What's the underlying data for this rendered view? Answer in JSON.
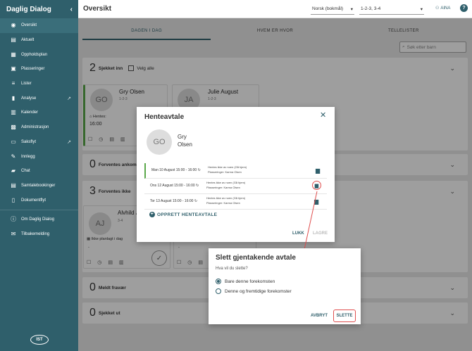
{
  "app": {
    "title": "Daglig Dialog",
    "collapse_icon": "chevron-left-icon"
  },
  "sidebar": {
    "items": [
      {
        "label": "Oversikt",
        "icon": "eye-icon",
        "active": true
      },
      {
        "label": "Aktuelt",
        "icon": "news-icon"
      },
      {
        "label": "Oppholdsplan",
        "icon": "calendar-plan-icon"
      },
      {
        "label": "Plasseringer",
        "icon": "person-card-icon"
      },
      {
        "label": "Lister",
        "icon": "list-icon"
      },
      {
        "label": "Analyse",
        "icon": "bar-chart-icon",
        "external": true
      },
      {
        "label": "Kalender",
        "icon": "calendar-icon"
      },
      {
        "label": "Administrasjon",
        "icon": "admin-icon"
      },
      {
        "label": "Saksflyt",
        "icon": "folder-icon",
        "external": true
      },
      {
        "label": "Innlegg",
        "icon": "pencil-icon"
      },
      {
        "label": "Chat",
        "icon": "chat-icon"
      },
      {
        "label": "Samtalebookinger",
        "icon": "booking-icon"
      },
      {
        "label": "Dokumentflyt",
        "icon": "document-icon"
      }
    ],
    "footer_items": [
      {
        "label": "Om Daglig Dialog",
        "icon": "info-icon"
      },
      {
        "label": "Tilbakemelding",
        "icon": "feedback-icon"
      }
    ],
    "logo_text": "IST"
  },
  "topbar": {
    "title": "Oversikt",
    "language": "Norsk (bokmål)",
    "filter": "1-2-3, 3-4",
    "user": "AINA",
    "help": "?"
  },
  "tabs": [
    {
      "label": "DAGEN I DAG",
      "active": true
    },
    {
      "label": "HVEM ER HVOR"
    },
    {
      "label": "TELLELISTER"
    }
  ],
  "search": {
    "placeholder": "Søk etter barn"
  },
  "sections": {
    "checked_in": {
      "count": "2",
      "label": "Sjekket inn",
      "select_all": "Velg alle"
    },
    "expected": {
      "count": "0",
      "label": "Forventes ankomm"
    },
    "not_expected": {
      "count": "3",
      "label": "Forventes ikke"
    },
    "absent": {
      "count": "0",
      "label": "Meldt fravær"
    },
    "checked_out": {
      "count": "0",
      "label": "Sjekket ut"
    }
  },
  "cards": {
    "gry": {
      "initials": "GO",
      "name": "Gry Olsen",
      "dept": "1-2-3",
      "pickup_label": "Hentes:",
      "pickup_time": "16:00"
    },
    "julie": {
      "initials": "JA",
      "name": "Julie August",
      "dept": "1-2-3"
    },
    "alvhild": {
      "initials": "AJ",
      "name": "Alvhild Jo",
      "dept": "3-4",
      "status": "Ikke planlagt i dag",
      "dash": "-"
    },
    "other_dash": "-"
  },
  "pickup_dialog": {
    "title": "Henteavtale",
    "child_initials": "GO",
    "child_first": "Gry",
    "child_last": "Olsen",
    "appointments": [
      {
        "date": "Man 10 August 15:00 - 16:00",
        "line1": "Hentes ikke av noen (Gå hjem)",
        "line2": "Plasseringer: Karma Olsen"
      },
      {
        "date": "Ons 12 August 15:00 - 16:00",
        "line1": "Hentes ikke av noen (Gå hjem)",
        "line2": "Plasseringer: Karma Olsen"
      },
      {
        "date": "Tor 13 August 15:00 - 16:00",
        "line1": "Hentes ikke av noen (Gå hjem)",
        "line2": "Plasseringer: Karma Olsen"
      }
    ],
    "create_label": "OPPRETT HENTEAVTALE",
    "close_label": "LUKK",
    "save_label": "LAGRE"
  },
  "delete_dialog": {
    "title": "Slett gjentakende avtale",
    "question": "Hva vil du slette?",
    "option1": "Bare denne forekomsten",
    "option2": "Denne og fremtidige forekomster",
    "selected": 1,
    "cancel_label": "AVBRYT",
    "delete_label": "SLETTE"
  },
  "colors": {
    "primary": "#2f5f6b",
    "highlight": "#e05050",
    "present": "#5aa84a"
  }
}
